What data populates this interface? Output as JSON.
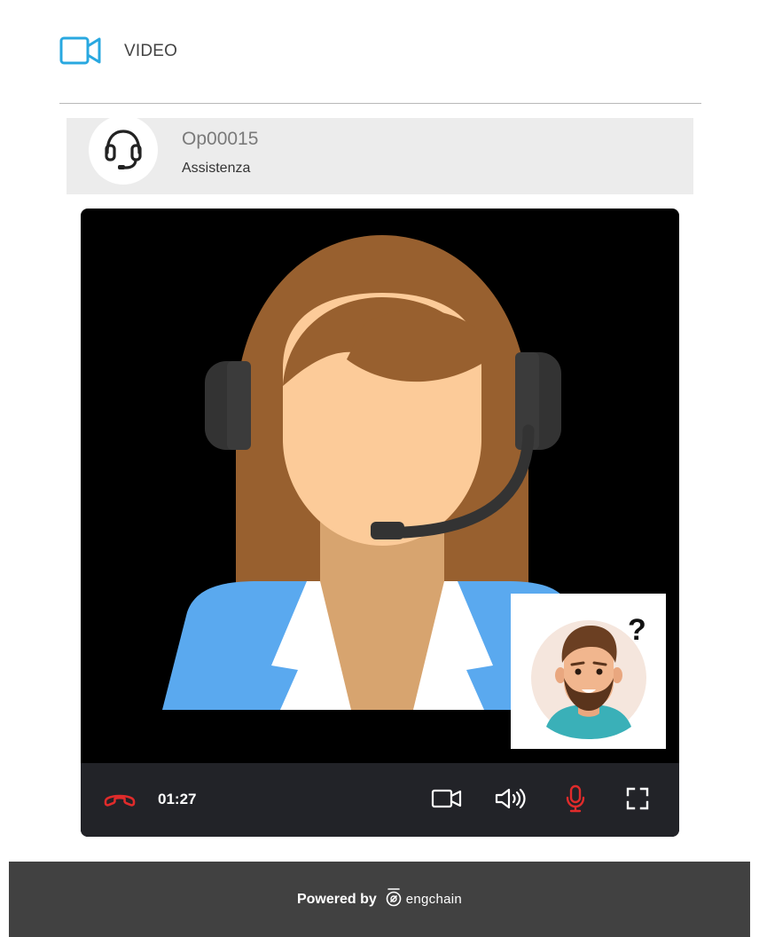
{
  "header": {
    "title": "VIDEO",
    "icon": "video-camera-icon",
    "accent_color": "#29a8e0"
  },
  "operator": {
    "name": "Op00015",
    "role": "Assistenza",
    "avatar_icon": "headset-operator-icon"
  },
  "call": {
    "timer": "01:27",
    "end_call_icon": "phone-hangup-icon",
    "camera_icon": "video-camera-icon",
    "speaker_icon": "speaker-icon",
    "mic_icon": "microphone-icon",
    "fullscreen_icon": "fullscreen-icon",
    "hangup_color": "#e02b2b",
    "mic_color": "#e02b2b"
  },
  "footer": {
    "powered_by": "Powered by",
    "brand": "engchain"
  }
}
